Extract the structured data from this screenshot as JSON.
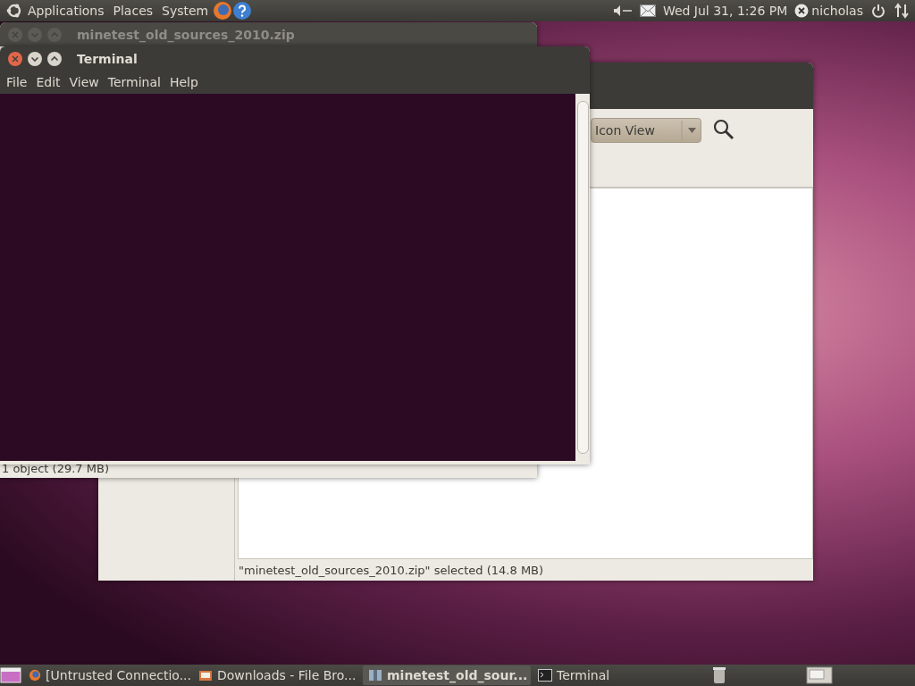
{
  "top_panel": {
    "menus": [
      "Applications",
      "Places",
      "System"
    ],
    "clock": "Wed Jul 31,  1:26 PM",
    "user": "nicholas"
  },
  "file_browser": {
    "view_mode": "Icon View",
    "status": "\"minetest_old_sources_2010.zip\" selected (14.8 MB)"
  },
  "archive_window": {
    "title": "minetest_old_sources_2010.zip",
    "active": false,
    "status": "1 object (29.7 MB)"
  },
  "terminal": {
    "title": "Terminal",
    "active": true,
    "menus": [
      "File",
      "Edit",
      "View",
      "Terminal",
      "Help"
    ]
  },
  "taskbar": {
    "items": [
      {
        "kind": "browser",
        "label": "[Untrusted Connectio...",
        "urgent": false
      },
      {
        "kind": "folder",
        "label": "Downloads - File Bro...",
        "urgent": false
      },
      {
        "kind": "archive",
        "label": "minetest_old_sour...",
        "urgent": true
      },
      {
        "kind": "terminal",
        "label": "Terminal",
        "urgent": false
      }
    ]
  }
}
